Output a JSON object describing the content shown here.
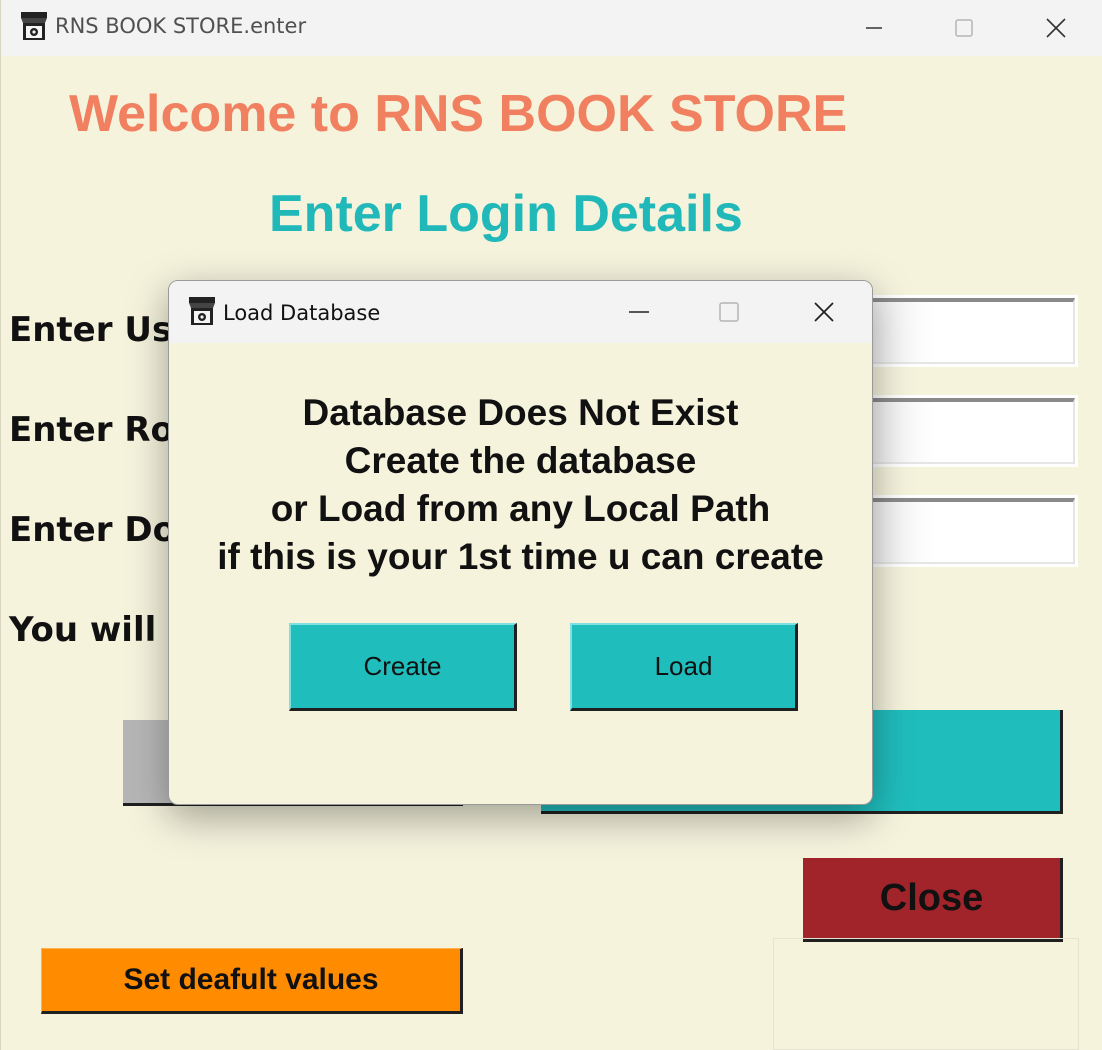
{
  "main_window": {
    "title": "RNS BOOK STORE.enter",
    "welcome": "Welcome to RNS BOOK STORE",
    "subheading": "Enter Login Details",
    "labels": [
      "Enter Us",
      "Enter Ro",
      "Enter Do",
      "You will b"
    ],
    "close_button": "Close",
    "default_button": "Set deafult values"
  },
  "dialog": {
    "title": "Load Database",
    "message_lines": [
      "Database Does Not Exist",
      "Create the database",
      "or Load from any Local Path",
      "if this is your 1st time u can create"
    ],
    "create_button": "Create",
    "load_button": "Load"
  },
  "colors": {
    "background": "#f5f3dc",
    "welcome": "#f08060",
    "subheading": "#20b8b8",
    "teal_button": "#20bdbd",
    "close_button": "#a0242a",
    "default_button": "#ff8c00"
  },
  "icons": [
    "store-icon",
    "minimize-icon",
    "maximize-icon",
    "close-icon"
  ]
}
